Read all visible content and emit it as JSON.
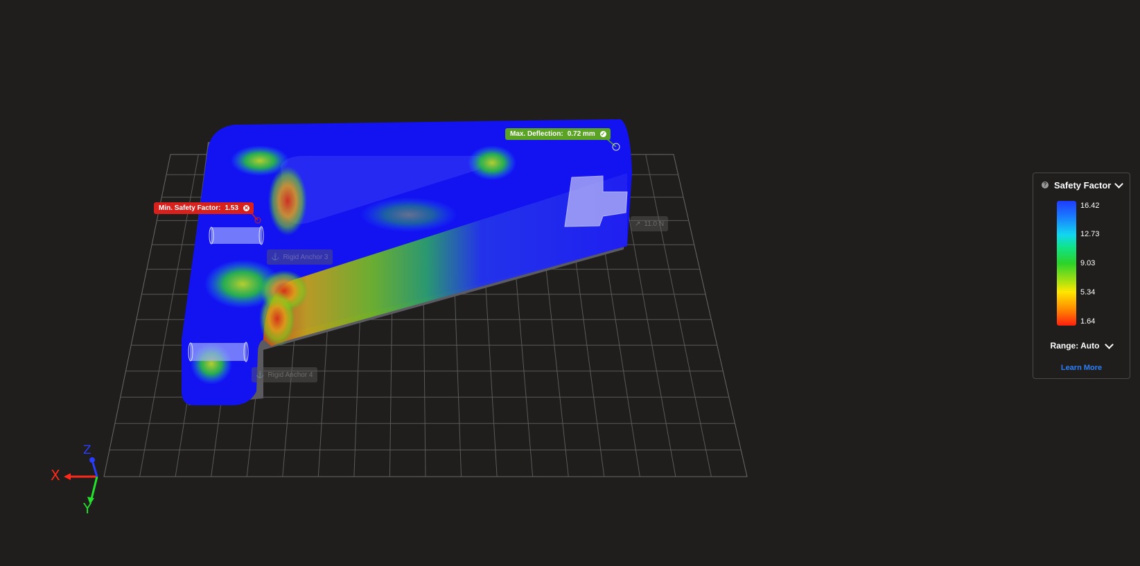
{
  "callouts": {
    "min_safety": {
      "label": "Min. Safety Factor:",
      "value": "1.53",
      "status_icon": "x-circle-icon",
      "color": "#d8211c"
    },
    "max_deflection": {
      "label": "Max. Deflection:",
      "value": "0.72 mm",
      "status_icon": "check-circle-icon",
      "color": "#5aa324"
    }
  },
  "scene_tags": {
    "anchor3": "Rigid Anchor 3",
    "anchor4": "Rigid Anchor 4",
    "force": "11.0 N"
  },
  "legend": {
    "title": "Safety Factor",
    "help_icon": "question-icon",
    "ticks": [
      "16.42",
      "12.73",
      "9.03",
      "5.34",
      "1.64"
    ],
    "range_label": "Range: Auto",
    "learn_more": "Learn More",
    "gradient_colors": [
      "#1f3cff",
      "#12d6f0",
      "#2bd32b",
      "#ffe600",
      "#ff1f10"
    ]
  },
  "axes": {
    "x": "X",
    "y": "Y",
    "z": "Z"
  },
  "colors": {
    "background": "#1f1e1d",
    "grid": "#6a6a6a",
    "part_blue": "#1515f5",
    "accent_link": "#2d7ff9"
  }
}
